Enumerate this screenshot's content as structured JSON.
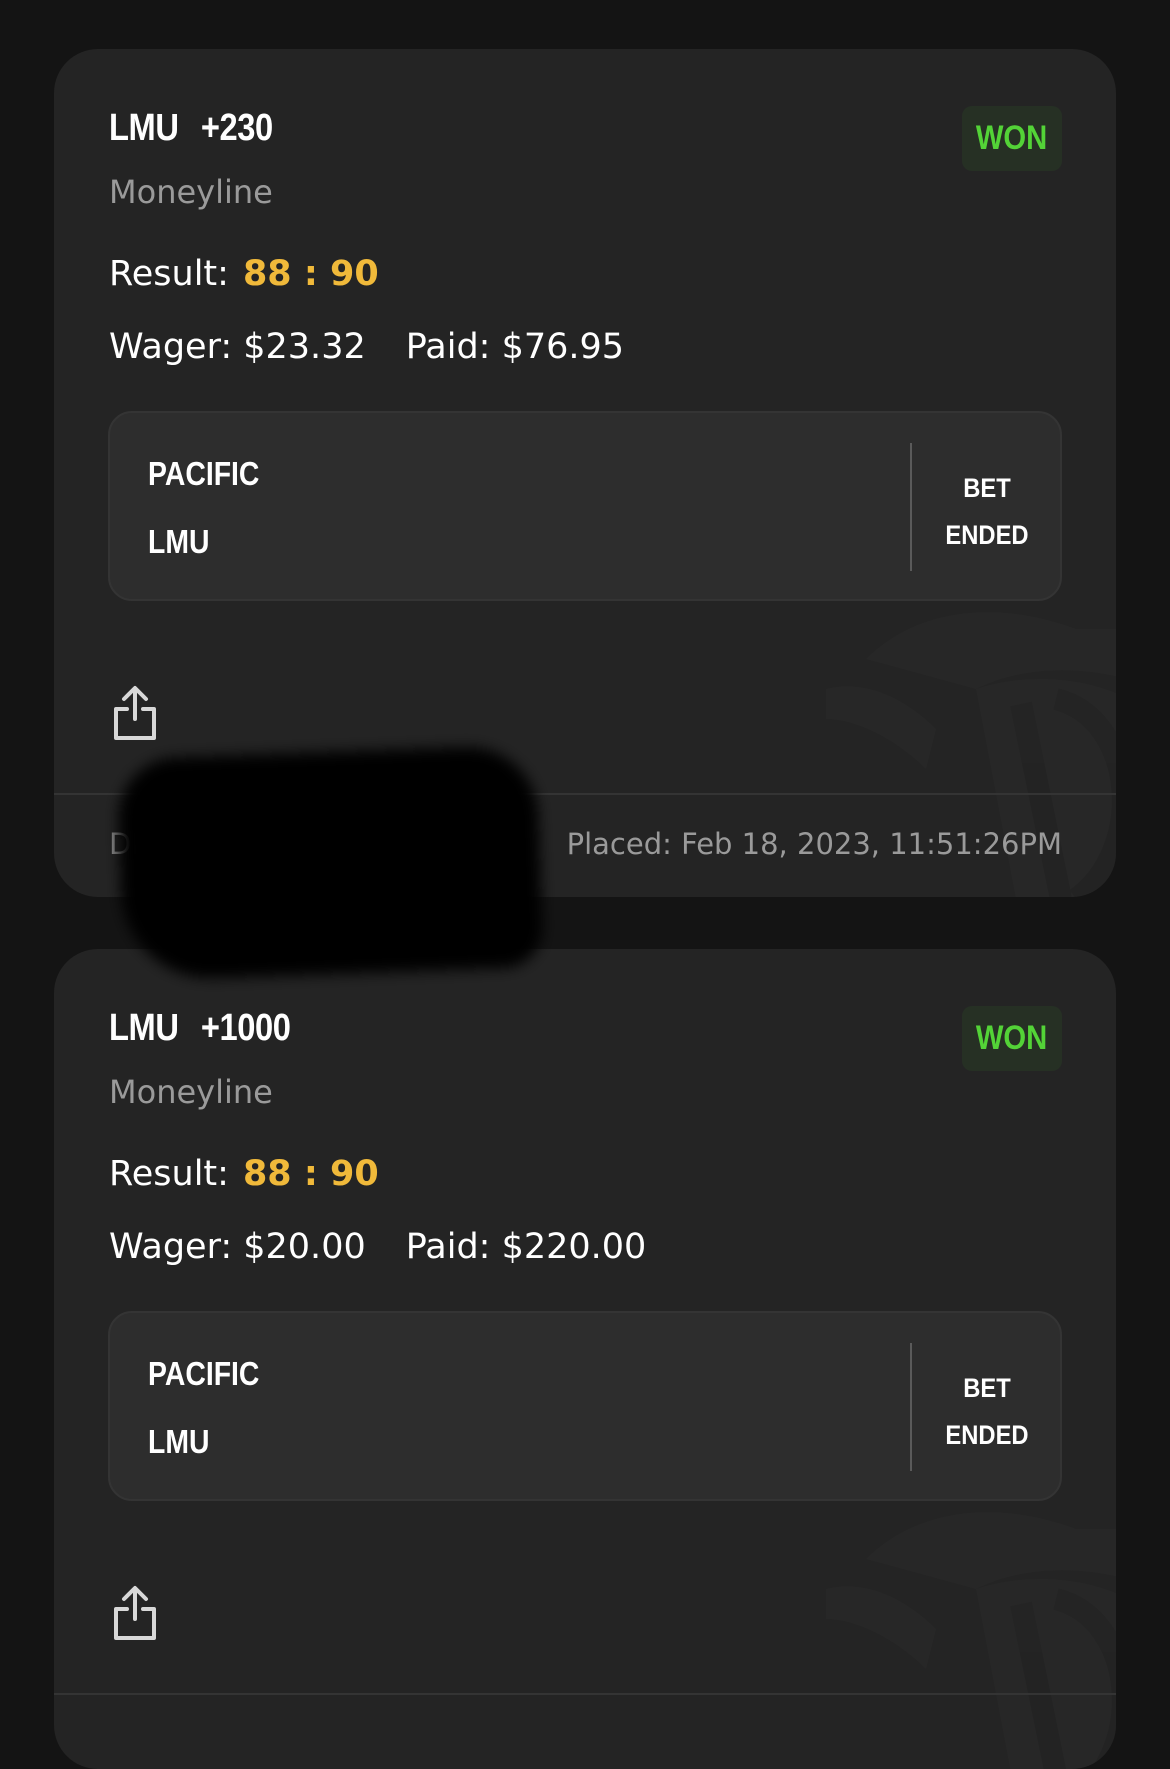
{
  "colors": {
    "page_background": "#141414",
    "card_background": "#242424",
    "won_green": "#53d337",
    "score_gold": "#f0b93a"
  },
  "bets": [
    {
      "team": "LMU",
      "odds": "+230",
      "market": "Moneyline",
      "status": "WON",
      "result_label": "Result:",
      "result_score": "88 : 90",
      "wager": "Wager: $23.32",
      "paid": "Paid: $76.95",
      "event": {
        "team_1": "PACIFIC",
        "team_2": "LMU",
        "status_line_1": "BET",
        "status_line_2": "ENDED"
      },
      "share_icon": "share-icon",
      "footer": {
        "id_visible": "DK",
        "placed": "Placed: Feb 18, 2023, 11:51:26PM"
      }
    },
    {
      "team": "LMU",
      "odds": "+1000",
      "market": "Moneyline",
      "status": "WON",
      "result_label": "Result:",
      "result_score": "88 : 90",
      "wager": "Wager: $20.00",
      "paid": "Paid: $220.00",
      "event": {
        "team_1": "PACIFIC",
        "team_2": "LMU",
        "status_line_1": "BET",
        "status_line_2": "ENDED"
      },
      "share_icon": "share-icon"
    }
  ]
}
